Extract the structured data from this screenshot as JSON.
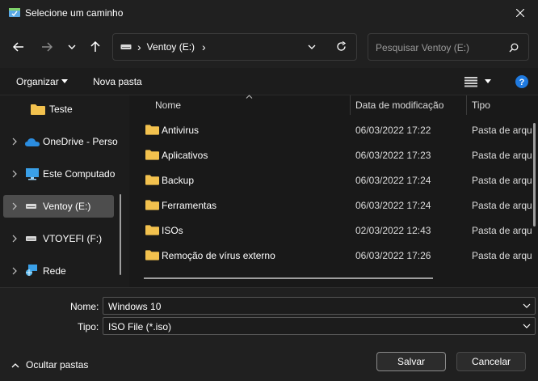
{
  "window": {
    "title": "Selecione um caminho"
  },
  "nav": {
    "back_icon": "arrow-left-icon",
    "forward_icon": "arrow-right-icon",
    "recent_icon": "chevron-down-icon",
    "up_icon": "arrow-up-icon"
  },
  "address": {
    "drive": "Ventoy (E:)",
    "separator": "›"
  },
  "search": {
    "placeholder": "Pesquisar Ventoy (E:)"
  },
  "toolbar": {
    "organize": "Organizar",
    "new_folder": "Nova pasta"
  },
  "sidebar": {
    "items": [
      {
        "label": "Teste",
        "icon": "folder-icon"
      },
      {
        "label": "OneDrive - Perso",
        "icon": "cloud-icon"
      },
      {
        "label": "Este Computado",
        "icon": "monitor-icon"
      },
      {
        "label": "Ventoy (E:)",
        "icon": "drive-icon"
      },
      {
        "label": "VTOYEFI (F:)",
        "icon": "drive-icon"
      },
      {
        "label": "Rede",
        "icon": "network-icon"
      }
    ]
  },
  "columns": {
    "name": "Nome",
    "date": "Data de modificação",
    "type": "Tipo"
  },
  "files": [
    {
      "name": "Antivirus",
      "date": "06/03/2022 17:22",
      "type": "Pasta de arqu"
    },
    {
      "name": "Aplicativos",
      "date": "06/03/2022 17:23",
      "type": "Pasta de arqu"
    },
    {
      "name": "Backup",
      "date": "06/03/2022 17:24",
      "type": "Pasta de arqu"
    },
    {
      "name": "Ferramentas",
      "date": "06/03/2022 17:24",
      "type": "Pasta de arqu"
    },
    {
      "name": "ISOs",
      "date": "02/03/2022 12:43",
      "type": "Pasta de arqu"
    },
    {
      "name": "Remoção de vírus externo",
      "date": "06/03/2022 17:26",
      "type": "Pasta de arqu"
    }
  ],
  "form": {
    "name_label": "Nome:",
    "name_value": "Windows 10",
    "type_label": "Tipo:",
    "type_value": "ISO File (*.iso)"
  },
  "footer": {
    "hide_folders": "Ocultar pastas",
    "save": "Salvar",
    "cancel": "Cancelar"
  },
  "colors": {
    "folder": "#f2c14e",
    "accent": "#4c9ee8",
    "bg": "#1c1c1c"
  }
}
